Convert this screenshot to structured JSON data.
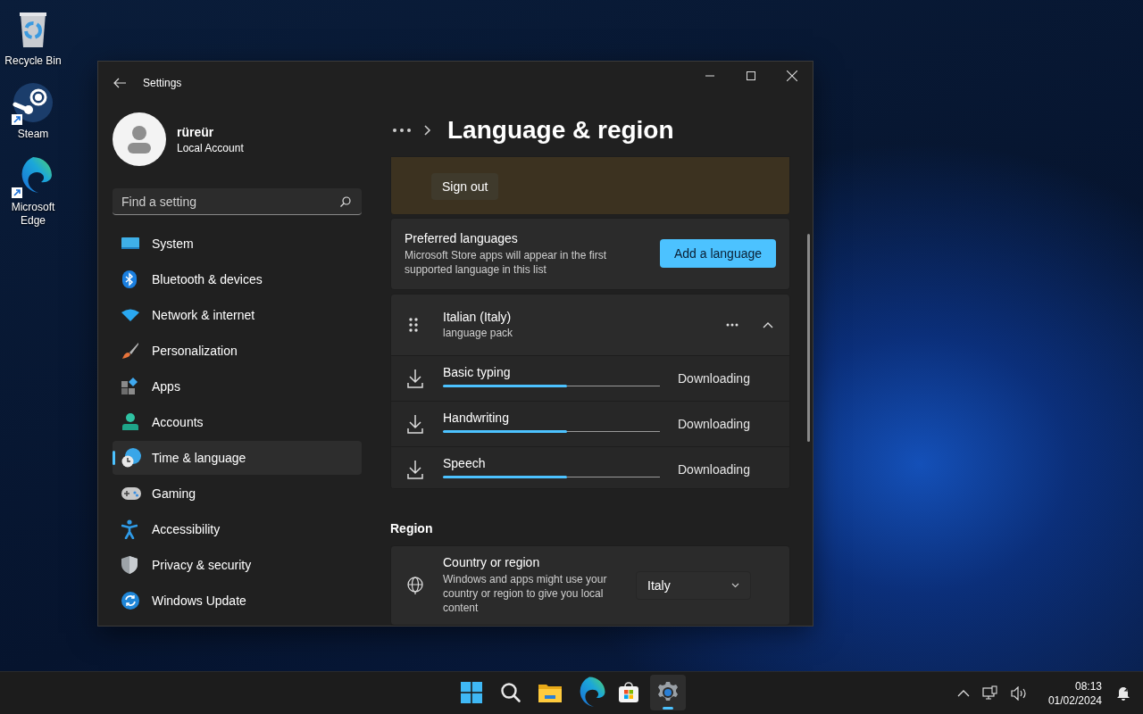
{
  "desktop_icons": [
    {
      "label": "Recycle Bin",
      "kind": "bin",
      "shortcut": false
    },
    {
      "label": "Steam",
      "kind": "steam",
      "shortcut": true
    },
    {
      "label": "Microsoft Edge",
      "kind": "edge",
      "shortcut": true
    }
  ],
  "window": {
    "title": "Settings"
  },
  "account": {
    "name": "rüreür",
    "type": "Local Account"
  },
  "search": {
    "placeholder": "Find a setting"
  },
  "sidebar": {
    "items": [
      {
        "label": "System",
        "kind": "system",
        "selected": false
      },
      {
        "label": "Bluetooth & devices",
        "kind": "bluetooth",
        "selected": false
      },
      {
        "label": "Network & internet",
        "kind": "network",
        "selected": false
      },
      {
        "label": "Personalization",
        "kind": "brush",
        "selected": false
      },
      {
        "label": "Apps",
        "kind": "apps",
        "selected": false
      },
      {
        "label": "Accounts",
        "kind": "accounts",
        "selected": false
      },
      {
        "label": "Time & language",
        "kind": "time",
        "selected": true
      },
      {
        "label": "Gaming",
        "kind": "gaming",
        "selected": false
      },
      {
        "label": "Accessibility",
        "kind": "accessibility",
        "selected": false
      },
      {
        "label": "Privacy & security",
        "kind": "shield",
        "selected": false
      },
      {
        "label": "Windows Update",
        "kind": "update",
        "selected": false
      }
    ]
  },
  "page_title": "Language & region",
  "sign_out_card": {
    "button": "Sign out"
  },
  "preferred_languages": {
    "title": "Preferred languages",
    "description": "Microsoft Store apps will appear in the first supported language in this list",
    "button": "Add a language"
  },
  "language": {
    "name": "Italian (Italy)",
    "detail": "language pack",
    "expanded": true,
    "features": [
      {
        "name": "Basic typing",
        "level": 0.57,
        "status": "Downloading"
      },
      {
        "name": "Handwriting",
        "level": 0.57,
        "status": "Downloading"
      },
      {
        "name": "Speech",
        "level": 0.57,
        "status": "Downloading"
      }
    ]
  },
  "region": {
    "heading": "Region",
    "title": "Country or region",
    "description": "Windows and apps might use your country or region to give you local content",
    "value": "Italy"
  },
  "taskbar": {
    "apps": [
      {
        "kind": "start",
        "selected": false
      },
      {
        "kind": "search",
        "selected": false
      },
      {
        "kind": "explorer",
        "selected": false
      },
      {
        "kind": "edge",
        "selected": false
      },
      {
        "kind": "store",
        "selected": false
      },
      {
        "kind": "settings",
        "selected": true
      }
    ],
    "time": "08:13",
    "date": "01/02/2024"
  }
}
